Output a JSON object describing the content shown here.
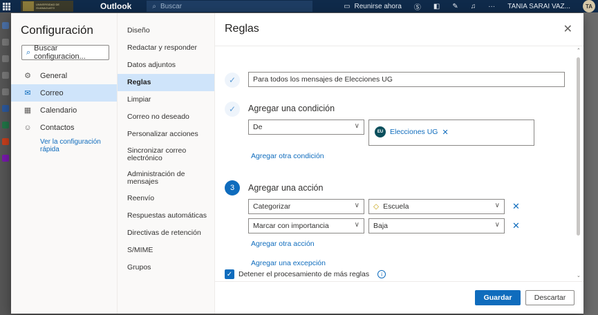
{
  "topbar": {
    "uni_lines": [
      "UNIVERSIDAD DE",
      "GUANAJUATO"
    ],
    "app_name": "Outlook",
    "search_placeholder": "Buscar",
    "meet_now": "Reunirse ahora",
    "user_name": "TANIA SARAI VAZ...",
    "user_initials": "TA"
  },
  "settings": {
    "title": "Configuración",
    "search_placeholder": "Buscar configuracion...",
    "categories": [
      {
        "label": "General",
        "icon": "gear-icon",
        "selected": false
      },
      {
        "label": "Correo",
        "icon": "mail-icon",
        "selected": true
      },
      {
        "label": "Calendario",
        "icon": "calendar-icon",
        "selected": false
      },
      {
        "label": "Contactos",
        "icon": "people-icon",
        "selected": false
      }
    ],
    "quick_config_link": "Ver la configuración rápida"
  },
  "mail_nav": {
    "items": [
      {
        "label": "Diseño"
      },
      {
        "label": "Redactar y responder"
      },
      {
        "label": "Datos adjuntos"
      },
      {
        "label": "Reglas",
        "selected": true
      },
      {
        "label": "Limpiar"
      },
      {
        "label": "Correo no deseado"
      },
      {
        "label": "Personalizar acciones"
      },
      {
        "label": "Sincronizar correo electrónico"
      },
      {
        "label": "Administración de mensajes"
      },
      {
        "label": "Reenvío"
      },
      {
        "label": "Respuestas automáticas"
      },
      {
        "label": "Directivas de retención"
      },
      {
        "label": "S/MIME"
      },
      {
        "label": "Grupos"
      }
    ]
  },
  "rules": {
    "title": "Reglas",
    "rule_name_value": "Para todos los mensajes de Elecciones UG",
    "condition_title": "Agregar una condición",
    "condition_field": "De",
    "condition_recipient": "Elecciones UG",
    "condition_recipient_initials": "EU",
    "add_condition_link": "Agregar otra condición",
    "step3_number": "3",
    "action_title": "Agregar una acción",
    "action1_field": "Categorizar",
    "action1_value": "Escuela",
    "action2_field": "Marcar con importancia",
    "action2_value": "Baja",
    "add_action_link": "Agregar otra acción",
    "add_exception_link": "Agregar una excepción",
    "stop_processing_label": "Detener el procesamiento de más reglas",
    "save_label": "Guardar",
    "discard_label": "Descartar"
  }
}
